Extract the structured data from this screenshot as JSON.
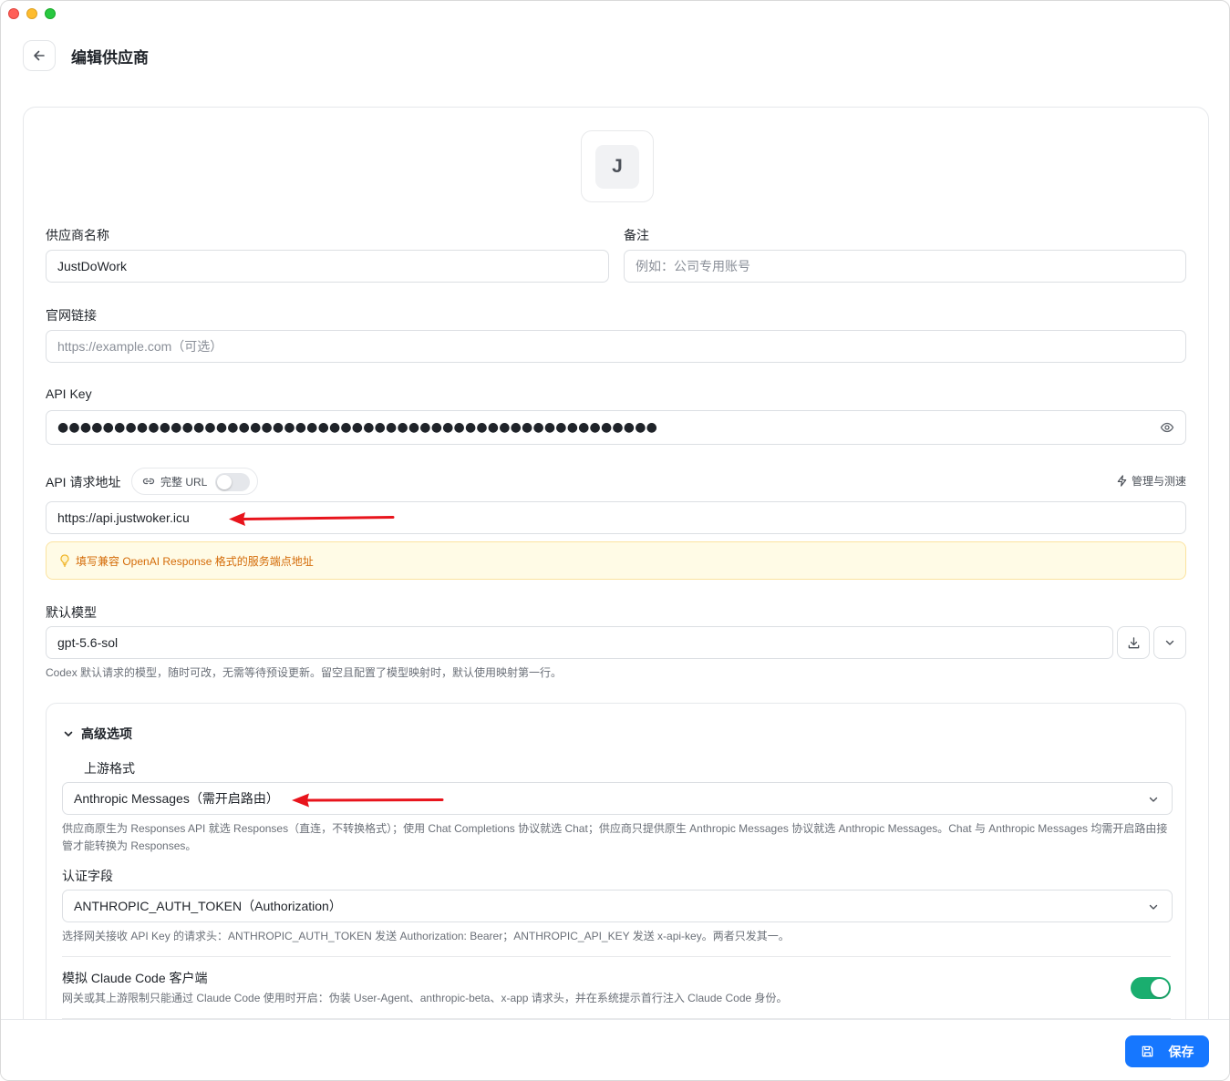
{
  "header": {
    "title": "编辑供应商"
  },
  "provider": {
    "avatar_letter": "J"
  },
  "fields": {
    "name": {
      "label": "供应商名称",
      "value": "JustDoWork"
    },
    "note": {
      "label": "备注",
      "placeholder": "例如：公司专用账号"
    },
    "website": {
      "label": "官网链接",
      "placeholder": "https://example.com（可选）"
    },
    "api_key": {
      "label": "API Key",
      "masked_value": "●●●●●●●●●●●●●●●●●●●●●●●●●●●●●●●●●●●●●●●●●●●●●●●●●●●●●"
    },
    "endpoint": {
      "label": "API 请求地址",
      "full_url_toggle_label": "完整 URL",
      "full_url_enabled": false,
      "manage_link": "管理与测速",
      "value": "https://api.justwoker.icu",
      "hint": "填写兼容 OpenAI Response 格式的服务端点地址"
    },
    "default_model": {
      "label": "默认模型",
      "value": "gpt-5.6-sol",
      "help": "Codex 默认请求的模型，随时可改，无需等待预设更新。留空且配置了模型映射时，默认使用映射第一行。"
    }
  },
  "advanced": {
    "title": "高级选项",
    "upstream_format": {
      "label": "上游格式",
      "selected": "Anthropic Messages（需开启路由）",
      "help": "供应商原生为 Responses API 就选 Responses（直连，不转换格式）；使用 Chat Completions 协议就选 Chat；供应商只提供原生 Anthropic Messages 协议就选 Anthropic Messages。Chat 与 Anthropic Messages 均需开启路由接管才能转换为 Responses。"
    },
    "auth_field": {
      "label": "认证字段",
      "selected": "ANTHROPIC_AUTH_TOKEN（Authorization）",
      "help": "选择网关接收 API Key 的请求头：ANTHROPIC_AUTH_TOKEN 发送 Authorization: Bearer；ANTHROPIC_API_KEY 发送 x-api-key。两者只发其一。"
    },
    "claude_code": {
      "label": "模拟 Claude Code 客户端",
      "help": "网关或其上游限制只能通过 Claude Code 使用时开启：伪装 User-Agent、anthropic-beta、x-app 请求头，并在系统提示首行注入 Claude Code 身份。",
      "enabled": true
    }
  },
  "footer": {
    "save_label": "保存"
  },
  "colors": {
    "primary": "#1677ff",
    "switch_on": "#1aae6f",
    "hint_text": "#d46b08",
    "arrow": "#e8141c"
  }
}
